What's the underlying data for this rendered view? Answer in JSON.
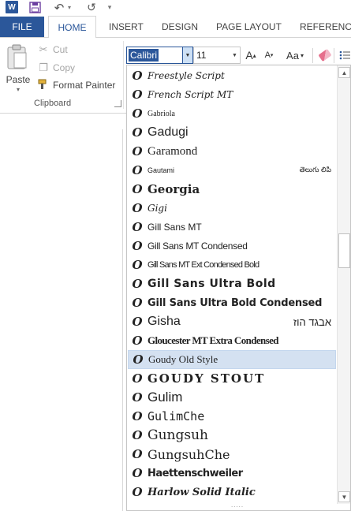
{
  "quick_access": {
    "word_logo": "W",
    "save_icon": "save-icon",
    "undo_icon": "undo-icon",
    "redo_icon": "redo-icon"
  },
  "tabs": {
    "file": "FILE",
    "home": "HOME",
    "insert": "INSERT",
    "design": "DESIGN",
    "page_layout": "PAGE LAYOUT",
    "references": "REFERENCES"
  },
  "clipboard": {
    "paste": "Paste",
    "cut": "Cut",
    "copy": "Copy",
    "format_painter": "Format Painter",
    "group_label": "Clipboard"
  },
  "font": {
    "name": "Calibri",
    "size": "11",
    "change_case": "Aa"
  },
  "colors": {
    "accent": "#2b579a",
    "selected_item": "#d4e1f1"
  },
  "font_list": [
    {
      "name": "Freestyle Script",
      "family": "\"DejaVu Serif\", serif",
      "style": "italic",
      "weight": "normal",
      "size": 12,
      "variant": "normal",
      "spacing": "0px",
      "sample": ""
    },
    {
      "name": "French Script MT",
      "family": "\"DejaVu Serif\", serif",
      "style": "italic",
      "weight": "normal",
      "size": 12,
      "variant": "normal",
      "spacing": "0px",
      "sample": ""
    },
    {
      "name": "Gabriola",
      "family": "\"Liberation Serif\", serif",
      "style": "normal",
      "weight": "normal",
      "size": 10,
      "variant": "normal",
      "spacing": "0px",
      "sample": ""
    },
    {
      "name": "Gadugi",
      "family": "\"Liberation Sans\", sans-serif",
      "style": "normal",
      "weight": "normal",
      "size": 16,
      "variant": "normal",
      "spacing": "0px",
      "sample": ""
    },
    {
      "name": "Garamond",
      "family": "\"Liberation Serif\", serif",
      "style": "normal",
      "weight": "normal",
      "size": 15,
      "variant": "normal",
      "spacing": "0px",
      "sample": ""
    },
    {
      "name": "Gautami",
      "family": "\"Liberation Sans\", sans-serif",
      "style": "normal",
      "weight": "normal",
      "size": 9,
      "variant": "normal",
      "spacing": "0px",
      "sample": "తెలుగు లిపి"
    },
    {
      "name": "Georgia",
      "family": "\"DejaVu Serif\", serif",
      "style": "normal",
      "weight": "bold",
      "size": 15,
      "variant": "normal",
      "spacing": "0px",
      "sample": ""
    },
    {
      "name": "Gigi",
      "family": "\"DejaVu Serif\", serif",
      "style": "italic",
      "weight": "normal",
      "size": 12,
      "variant": "normal",
      "spacing": "0px",
      "sample": ""
    },
    {
      "name": "Gill Sans MT",
      "family": "\"Liberation Sans\", sans-serif",
      "style": "normal",
      "weight": "normal",
      "size": 12,
      "variant": "normal",
      "spacing": "0px",
      "sample": ""
    },
    {
      "name": "Gill Sans MT Condensed",
      "family": "\"Liberation Sans\", sans-serif",
      "style": "normal",
      "weight": "normal",
      "size": 12,
      "variant": "normal",
      "spacing": "-0.3px",
      "sample": ""
    },
    {
      "name": "Gill Sans MT Ext Condensed Bold",
      "family": "\"Liberation Sans\", sans-serif",
      "style": "normal",
      "weight": "normal",
      "size": 11,
      "variant": "normal",
      "spacing": "-0.8px",
      "sample": ""
    },
    {
      "name": "Gill Sans Ultra Bold",
      "family": "\"DejaVu Sans\", sans-serif",
      "style": "normal",
      "weight": "bold",
      "size": 14,
      "variant": "normal",
      "spacing": "0.5px",
      "sample": ""
    },
    {
      "name": "Gill Sans Ultra Bold Condensed",
      "family": "\"DejaVu Sans\", sans-serif",
      "style": "normal",
      "weight": "bold",
      "size": 13,
      "variant": "normal",
      "spacing": "-0.2px",
      "sample": ""
    },
    {
      "name": "Gisha",
      "family": "\"Liberation Sans\", sans-serif",
      "style": "normal",
      "weight": "normal",
      "size": 16,
      "variant": "normal",
      "spacing": "0px",
      "sample": "אבגד הוז"
    },
    {
      "name": "Gloucester MT Extra Condensed",
      "family": "\"Liberation Serif\", serif",
      "style": "normal",
      "weight": "bold",
      "size": 13,
      "variant": "normal",
      "spacing": "-0.6px",
      "sample": ""
    },
    {
      "name": "Goudy Old Style",
      "family": "\"Liberation Serif\", serif",
      "style": "normal",
      "weight": "normal",
      "size": 13,
      "variant": "normal",
      "spacing": "0px",
      "sample": ""
    },
    {
      "name": "GOUDY STOUT",
      "family": "\"DejaVu Serif\", serif",
      "style": "normal",
      "weight": "bold",
      "size": 15,
      "variant": "normal",
      "spacing": "2px",
      "sample": ""
    },
    {
      "name": "Gulim",
      "family": "\"Liberation Sans\", sans-serif",
      "style": "normal",
      "weight": "normal",
      "size": 17,
      "variant": "normal",
      "spacing": "0px",
      "sample": ""
    },
    {
      "name": "GulimChe",
      "family": "\"DejaVu Sans Mono\", monospace",
      "style": "normal",
      "weight": "normal",
      "size": 15,
      "variant": "normal",
      "spacing": "0px",
      "sample": ""
    },
    {
      "name": "Gungsuh",
      "family": "\"DejaVu Serif\", serif",
      "style": "normal",
      "weight": "normal",
      "size": 17,
      "variant": "normal",
      "spacing": "0px",
      "sample": ""
    },
    {
      "name": "GungsuhChe",
      "family": "\"DejaVu Serif\", serif",
      "style": "normal",
      "weight": "normal",
      "size": 16,
      "variant": "normal",
      "spacing": "0px",
      "sample": ""
    },
    {
      "name": "Haettenschweiler",
      "family": "\"DejaVu Sans\", sans-serif",
      "style": "normal",
      "weight": "bold",
      "size": 13,
      "variant": "normal",
      "spacing": "-0.5px",
      "sample": ""
    },
    {
      "name": "Harlow Solid Italic",
      "family": "\"DejaVu Serif\", serif",
      "style": "italic",
      "weight": "bold",
      "size": 13,
      "variant": "normal",
      "spacing": "0px",
      "sample": ""
    }
  ],
  "selected_font": "Goudy Old Style"
}
